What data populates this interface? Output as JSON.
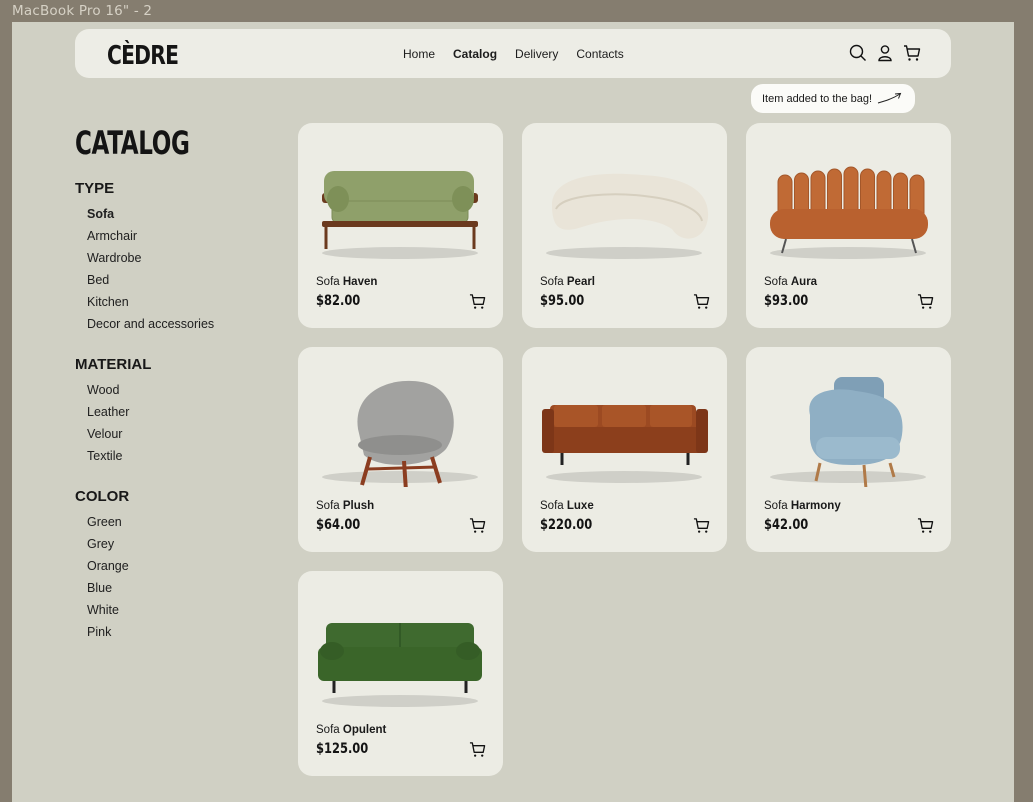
{
  "frame_label": "MacBook Pro 16\" - 2",
  "header": {
    "logo": "CÈDRE",
    "nav": [
      "Home",
      "Catalog",
      "Delivery",
      "Contacts"
    ],
    "active_nav": "Catalog",
    "icons": [
      "search-icon",
      "user-icon",
      "cart-icon"
    ]
  },
  "toast": {
    "message": "Item added to the bag!"
  },
  "sidebar": {
    "title": "CATALOG",
    "groups": [
      {
        "title": "TYPE",
        "items": [
          "Sofa",
          "Armchair",
          "Wardrobe",
          "Bed",
          "Kitchen",
          "Decor and accessories"
        ],
        "selected": "Sofa"
      },
      {
        "title": "MATERIAL",
        "items": [
          "Wood",
          "Leather",
          "Velour",
          "Textile"
        ]
      },
      {
        "title": "COLOR",
        "items": [
          "Green",
          "Grey",
          "Orange",
          "Blue",
          "White",
          "Pink"
        ]
      }
    ]
  },
  "products": [
    {
      "prefix": "Sofa",
      "name": "Haven",
      "price": "$82.00",
      "color": "#8fa06a",
      "kind": "sofa-wood"
    },
    {
      "prefix": "Sofa",
      "name": "Pearl",
      "price": "$95.00",
      "color": "#e9e4d8",
      "kind": "sofa-curve"
    },
    {
      "prefix": "Sofa",
      "name": "Aura",
      "price": "$93.00",
      "color": "#c06a35",
      "kind": "sofa-shell"
    },
    {
      "prefix": "Sofa",
      "name": "Plush",
      "price": "$64.00",
      "color": "#a2a2a0",
      "kind": "chair-egg"
    },
    {
      "prefix": "Sofa",
      "name": "Luxe",
      "price": "$220.00",
      "color": "#9c4a22",
      "kind": "sofa-leather"
    },
    {
      "prefix": "Sofa",
      "name": "Harmony",
      "price": "$42.00",
      "color": "#8fafc4",
      "kind": "chair-arm"
    },
    {
      "prefix": "Sofa",
      "name": "Opulent",
      "price": "$125.00",
      "color": "#3f6a2f",
      "kind": "sofa-velvet"
    }
  ],
  "colors": {
    "background": "#d0d0c4",
    "card": "#ecece4",
    "header": "#edede6",
    "outer": "#857d6f"
  }
}
